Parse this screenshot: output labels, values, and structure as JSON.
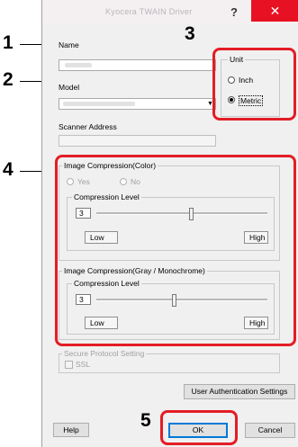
{
  "window": {
    "title": "Kyocera TWAIN Driver",
    "help_glyph": "?",
    "close_glyph": "✕"
  },
  "callouts": {
    "n1": "1",
    "n2": "2",
    "n3": "3",
    "n4": "4",
    "n5": "5"
  },
  "name": {
    "label": "Name"
  },
  "model": {
    "label": "Model"
  },
  "scanner_address": {
    "label": "Scanner Address",
    "value": ""
  },
  "unit": {
    "title": "Unit",
    "options": [
      "Inch",
      "Metric"
    ],
    "selected": "Metric"
  },
  "color_compression": {
    "title": "Image Compression(Color)",
    "yes_label": "Yes",
    "no_label": "No",
    "level_title": "Compression Level",
    "level_value": "3",
    "slider_level": 0.55,
    "low_label": "Low",
    "high_label": "High"
  },
  "gray_compression": {
    "title": "Image Compression(Gray / Monochrome)",
    "level_title": "Compression Level",
    "level_value": "3",
    "slider_level": 0.45,
    "low_label": "Low",
    "high_label": "High"
  },
  "secure": {
    "title": "Secure Protocol Setting",
    "ssl_label": "SSL"
  },
  "buttons": {
    "user_auth": "User Authentication Settings",
    "help": "Help",
    "ok": "OK",
    "cancel": "Cancel"
  },
  "colors": {
    "callout_red": "#e31d25",
    "close_red": "#e81123"
  }
}
